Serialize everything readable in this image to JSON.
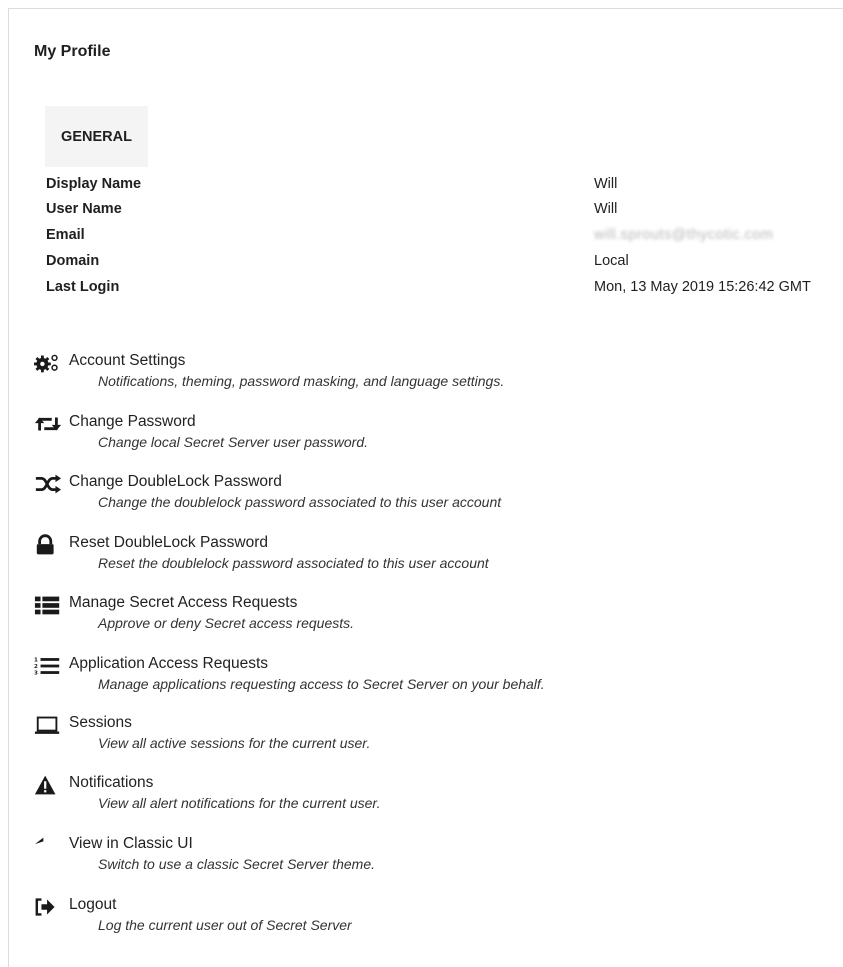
{
  "page": {
    "title": "My Profile"
  },
  "tabs": [
    {
      "label": "GENERAL"
    }
  ],
  "general": {
    "fields": [
      {
        "label": "Display Name",
        "value": "Will"
      },
      {
        "label": "User Name",
        "value": "Will"
      },
      {
        "label": "Email",
        "value": "will.sprouts@thycotic.com"
      },
      {
        "label": "Domain",
        "value": "Local"
      },
      {
        "label": "Last Login",
        "value": "Mon, 13 May 2019 15:26:42 GMT"
      }
    ]
  },
  "menu": [
    {
      "icon": "cogs-icon",
      "title": "Account Settings",
      "desc": "Notifications, theming, password masking, and language settings."
    },
    {
      "icon": "retweet-icon",
      "title": "Change Password",
      "desc": "Change local Secret Server user password."
    },
    {
      "icon": "shuffle-icon",
      "title": "Change DoubleLock Password",
      "desc": "Change the doublelock password associated to this user account"
    },
    {
      "icon": "lock-icon",
      "title": "Reset DoubleLock Password",
      "desc": "Reset the doublelock password associated to this user account"
    },
    {
      "icon": "list-icon",
      "title": "Manage Secret Access Requests",
      "desc": "Approve or deny Secret access requests."
    },
    {
      "icon": "numbered-list-icon",
      "title": "Application Access Requests",
      "desc": "Manage applications requesting access to Secret Server on your behalf."
    },
    {
      "icon": "laptop-icon",
      "title": "Sessions",
      "desc": "View all active sessions for the current user."
    },
    {
      "icon": "warning-icon",
      "title": "Notifications",
      "desc": "View all alert notifications for the current user."
    },
    {
      "icon": "reply-icon",
      "title": "View in Classic UI",
      "desc": "Switch to use a classic Secret Server theme."
    },
    {
      "icon": "sign-out-icon",
      "title": "Logout",
      "desc": "Log the current user out of Secret Server"
    }
  ]
}
